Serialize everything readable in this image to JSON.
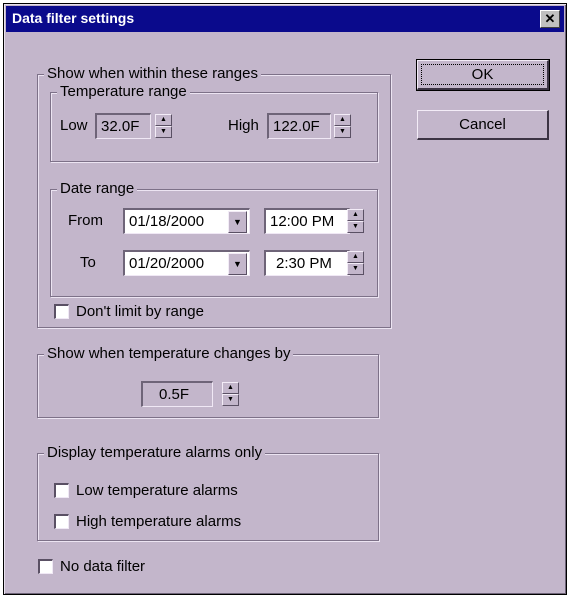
{
  "window": {
    "title": "Data filter settings",
    "close_glyph": "✕"
  },
  "buttons": {
    "ok": "OK",
    "cancel": "Cancel"
  },
  "ranges_group": {
    "label": "Show when within these ranges",
    "temperature": {
      "label": "Temperature range",
      "low_label": "Low",
      "low_value": "32.0F",
      "high_label": "High",
      "high_value": "122.0F"
    },
    "date": {
      "label": "Date range",
      "from_label": "From",
      "from_date": "01/18/2000",
      "from_time": "12:00 PM",
      "to_label": "To",
      "to_date": "01/20/2000",
      "to_time": "2:30 PM"
    },
    "dont_limit": {
      "label": "Don't limit by range",
      "checked": false
    }
  },
  "change_group": {
    "label": "Show when temperature changes by",
    "value": "0.5F"
  },
  "alarms_group": {
    "label": "Display temperature alarms only",
    "low": {
      "label": "Low temperature alarms",
      "checked": false
    },
    "high": {
      "label": "High temperature alarms",
      "checked": false
    }
  },
  "no_filter": {
    "label": "No data filter",
    "checked": false
  },
  "icons": {
    "spin_up": "▲",
    "spin_down": "▼",
    "dropdown": "▼"
  }
}
